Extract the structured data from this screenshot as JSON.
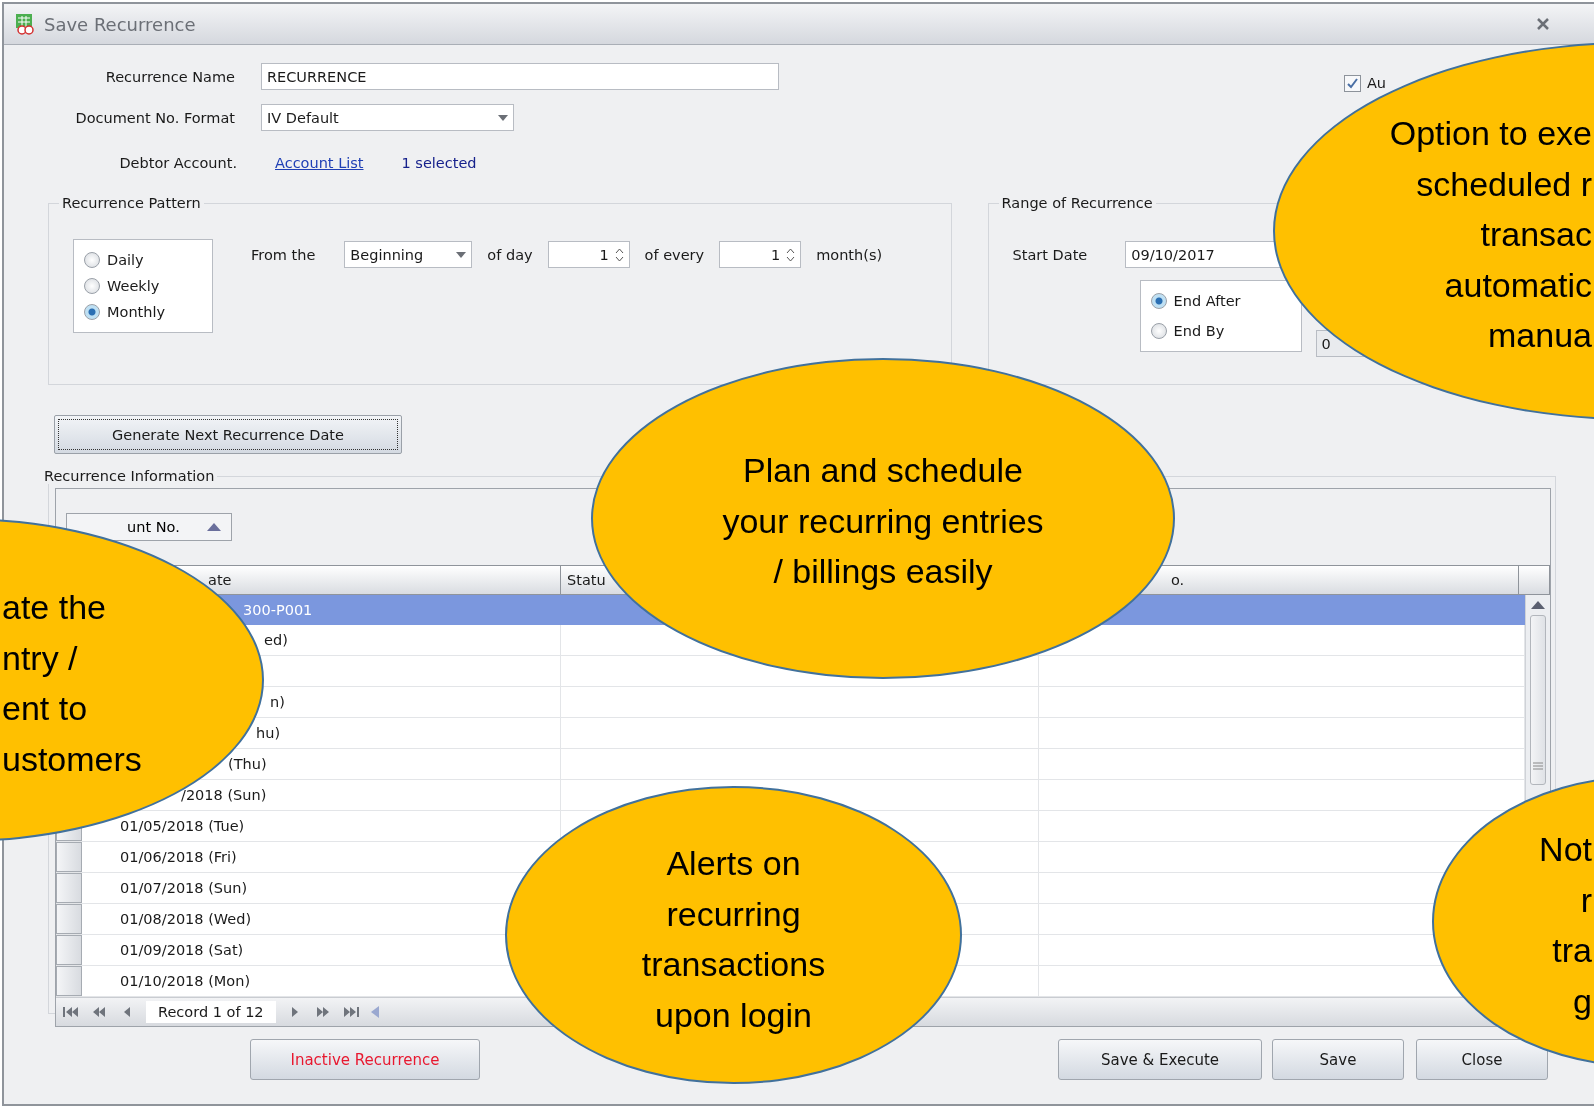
{
  "window": {
    "title": "Save Recurrence"
  },
  "form": {
    "recurrence_name": {
      "label": "Recurrence Name",
      "value": "RECURRENCE"
    },
    "document_format": {
      "label": "Document No. Format",
      "value": "IV Default"
    },
    "debtor_account": {
      "label": "Debtor Account.",
      "link": "Account List",
      "count": "1 selected"
    },
    "auto_checkbox": {
      "label": "Au",
      "checked": true
    }
  },
  "recurrence_pattern": {
    "title": "Recurrence Pattern",
    "options": [
      {
        "label": "Daily",
        "selected": false
      },
      {
        "label": "Weekly",
        "selected": false
      },
      {
        "label": "Monthly",
        "selected": true
      }
    ],
    "from_label": "From the",
    "position": "Beginning",
    "of_day_label": "of day",
    "day": "1",
    "of_every_label": "of every",
    "every": "1",
    "unit_label": "month(s)"
  },
  "range": {
    "title": "Range of Recurrence",
    "start_label": "Start Date",
    "start_value": "09/10/2017",
    "end_options": [
      {
        "label": "End After",
        "selected": true
      },
      {
        "label": "End By",
        "selected": false
      }
    ],
    "end_by_value": "0"
  },
  "generate_button": "Generate Next Recurrence Date",
  "recurrence_information": {
    "title": "Recurrence Information",
    "group_by": "unt No.",
    "columns": [
      "ate",
      "Statu",
      "o."
    ],
    "rows": [
      {
        "kind": "group",
        "text": "300-P001",
        "selected": true
      },
      {
        "kind": "data",
        "date": "ed)",
        "selected": false
      },
      {
        "kind": "data",
        "selected": false
      },
      {
        "kind": "data",
        "date": "n)",
        "selected": false
      },
      {
        "kind": "data",
        "date": "hu)",
        "selected": false
      },
      {
        "kind": "data",
        "date": "(Thu)",
        "selected": false
      },
      {
        "kind": "data",
        "date": "/2018 (Sun)",
        "selected": false
      },
      {
        "kind": "data",
        "date": "01/05/2018 (Tue)",
        "selected": false
      },
      {
        "kind": "data",
        "date": "01/06/2018 (Fri)",
        "selected": false
      },
      {
        "kind": "data",
        "date": "01/07/2018 (Sun)",
        "selected": false
      },
      {
        "kind": "data",
        "date": "01/08/2018 (Wed)",
        "selected": false
      },
      {
        "kind": "data",
        "date": "01/09/2018 (Sat)",
        "selected": false
      },
      {
        "kind": "data",
        "date": "01/10/2018 (Mon)",
        "selected": false
      }
    ],
    "record": "Record 1 of 12"
  },
  "buttons": [
    {
      "label": "Inactive Recurrence",
      "kind": "danger"
    },
    {
      "label": "Save & Execute",
      "kind": "normal"
    },
    {
      "label": "Save",
      "kind": "normal"
    },
    {
      "label": "Close",
      "kind": "normal"
    }
  ],
  "callouts": [
    {
      "lines": [
        "Option to exe",
        "scheduled r",
        "transac",
        "automatic",
        "manua"
      ]
    },
    {
      "lines": [
        "Plan and schedule",
        "your recurring entries",
        "/ billings easily"
      ]
    },
    {
      "lines": [
        "ate the",
        "ntry /",
        "ent to",
        "ustomers"
      ]
    },
    {
      "lines": [
        "Alerts on",
        "recurring",
        "transactions",
        "upon login"
      ]
    },
    {
      "lines": [
        "Not",
        "r",
        "tra",
        "g"
      ]
    }
  ]
}
